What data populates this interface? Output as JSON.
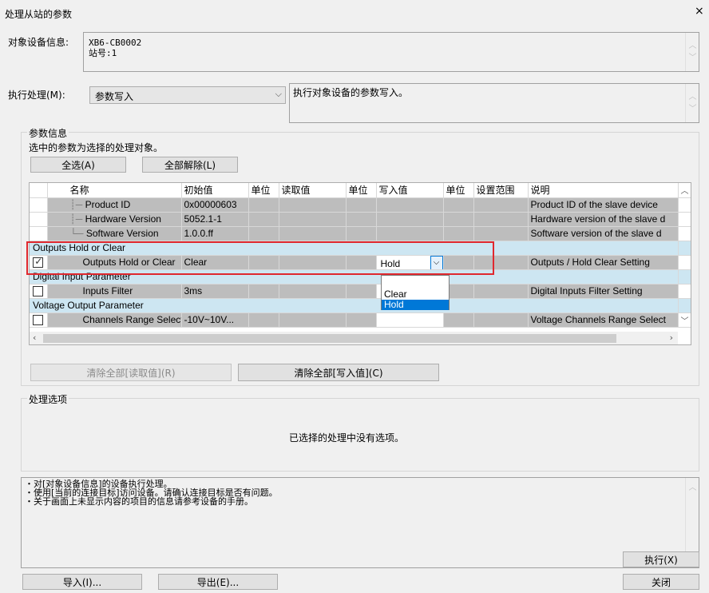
{
  "window": {
    "title": "处理从站的参数",
    "close": "×"
  },
  "device_info": {
    "label": "对象设备信息:",
    "line1": "XB6-CB0002",
    "line2": "站号:1"
  },
  "execute": {
    "label": "执行处理(M):",
    "selected": "参数写入",
    "description": "执行对象设备的参数写入。"
  },
  "params": {
    "group_title": "参数信息",
    "hint": "选中的参数为选择的处理对象。",
    "select_all": "全选(A)",
    "deselect_all": "全部解除(L)",
    "headers": [
      "名称",
      "初始值",
      "单位",
      "读取值",
      "单位",
      "写入值",
      "单位",
      "设置范围",
      "说明"
    ],
    "rows": [
      {
        "name": "Product ID",
        "init": "0x00000603",
        "desc": "Product ID of the slave device"
      },
      {
        "name": "Hardware Version",
        "init": "5052.1-1",
        "desc": "Hardware version of the slave d"
      },
      {
        "name": "Software Version",
        "init": "1.0.0.ff",
        "desc": "Software version of the slave d"
      }
    ],
    "section1": "Outputs Hold or Clear",
    "row_outputs": {
      "name": "Outputs Hold or Clear",
      "init": "Clear",
      "write": "Hold",
      "desc": "Outputs / Hold Clear Setting",
      "checked": true
    },
    "section2": "Digital Input Parameter",
    "row_inputs": {
      "name": "Inputs Filter",
      "init": "3ms",
      "desc": "Digital Inputs Filter Setting"
    },
    "section3": "Voltage Output Parameter",
    "row_voltage": {
      "name": "Channels Range Select",
      "init": "-10V~10V...",
      "desc": "Voltage Channels Range Select"
    },
    "dropdown_options": [
      "Clear",
      "Hold"
    ],
    "dropdown_selected": "Hold",
    "clear_read": "清除全部[读取值](R)",
    "clear_write": "清除全部[写入值](C)"
  },
  "options": {
    "group_title": "处理选项",
    "empty_msg": "已选择的处理中没有选项。"
  },
  "notes": {
    "line1": "・对[对象设备信息]的设备执行处理。",
    "line2": "・使用[当前的连接目标]访问设备。请确认连接目标是否有问题。",
    "line3": "・关于画面上未显示内容的项目的信息请参考设备的手册。"
  },
  "buttons": {
    "execute": "执行(X)",
    "import": "导入(I)...",
    "export": "导出(E)...",
    "close": "关闭"
  },
  "colors": {
    "highlight_red": "#e0282e",
    "section_blue": "#cde6f2",
    "selection_blue": "#0078d7"
  }
}
